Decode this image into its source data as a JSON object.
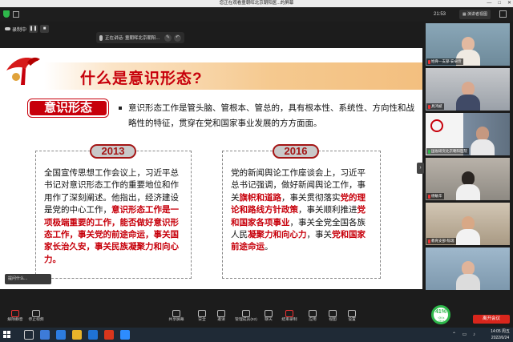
{
  "window": {
    "title": "您正在观看童朝晖北京朝阳医...的屏幕",
    "controls": [
      "—",
      "□",
      "✕"
    ]
  },
  "topbar": {
    "timer": "21:53",
    "view_label": "演讲者视图"
  },
  "recording": {
    "label": "录制中",
    "pause": "❚❚",
    "stop": "■"
  },
  "speaking": {
    "text": "正在讲话: 童朝晖北京朝阳..."
  },
  "slide": {
    "title": "什么是意识形态?",
    "label": "意识形态",
    "definition": "意识形态工作是管头脑、管根本、管总的，具有根本性、系统性、方向性和战略性的特征，贯穿在党和国家事业发展的方方面面。",
    "box1": {
      "year": "2013",
      "text_plain": "全国宣传思想工作会议上，习近平总书记对意识形态工作的重要地位和作用作了深刻阐述。他指出，经济建设是党的中心工作，",
      "text_highlight": "意识形态工作是一项极端重要的工作，能否做好意识形态工作，事关党的前途命运，事关国家长治久安，事关民族凝聚力和向心力。"
    },
    "box2": {
      "year": "2016",
      "p1": "党的新闻舆论工作座谈会上，习近平总书记强调，做好新闻舆论工作，事关",
      "h1": "旗帜和道路",
      "p2": "，事关贯彻落实",
      "h2": "党的理论和路线方针政策",
      "p3": "，事关顺利推进",
      "h3": "党和国家各项事业",
      "p4": "，事关全党全国各族人民",
      "h4": "凝聚力和向心力",
      "p5": "，事关",
      "h5": "党和国家前途命运",
      "p6": "。"
    },
    "assist_label": "提问什么..."
  },
  "participants": [
    {
      "name": "姓骨—支部-安卓玲"
    },
    {
      "name": "具鸿斌"
    },
    {
      "name": "国省研究北京朝阳医院"
    },
    {
      "name": "杨敏华"
    },
    {
      "name": "教育支部-陈瑞"
    },
    {
      "name": ""
    }
  ],
  "bottombar": {
    "items": [
      {
        "label": "解除静音",
        "icon": "mic-muted-icon"
      },
      {
        "label": "停止视频",
        "icon": "video-icon"
      },
      {
        "label": "共享屏幕",
        "icon": "share-screen-icon"
      },
      {
        "label": "安全",
        "icon": "shield-icon"
      },
      {
        "label": "邀请",
        "icon": "invite-icon"
      },
      {
        "label": "管理成员(92)",
        "icon": "members-icon"
      },
      {
        "label": "聊天",
        "icon": "chat-icon"
      },
      {
        "label": "结束录制",
        "icon": "record-icon"
      },
      {
        "label": "应用",
        "icon": "apps-icon"
      },
      {
        "label": "视图",
        "icon": "view-icon"
      },
      {
        "label": "设置",
        "icon": "settings-icon"
      }
    ],
    "leave_label": "离开会议",
    "network_percent": "41%",
    "network_sub": "↑0K/s ↓0K/s"
  },
  "taskbar": {
    "time": "14:05 周五",
    "date": "2022/6/24"
  },
  "colors": {
    "accent_red": "#c7000b",
    "recording_green": "#2eb84b",
    "leave_red": "#d9261c"
  }
}
